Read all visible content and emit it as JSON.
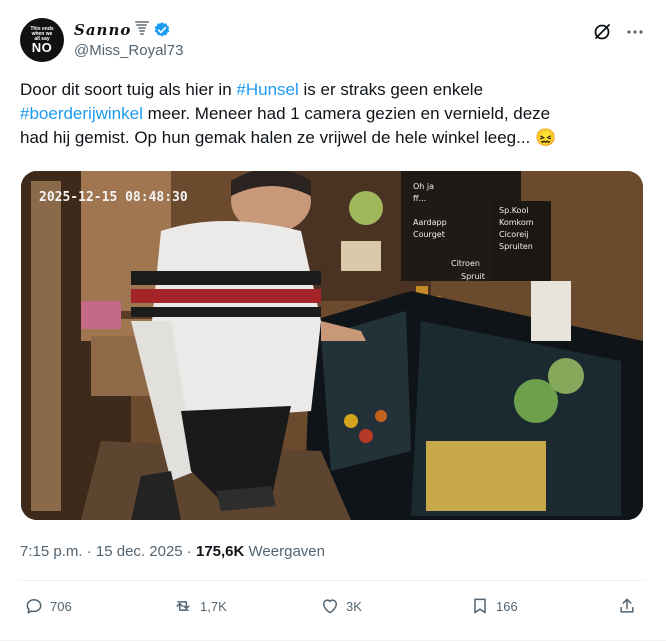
{
  "author": {
    "avatar_line1": "This ends",
    "avatar_line2": "when we",
    "avatar_line3": "all say",
    "avatar_big": "NO",
    "display_name": "Sanno",
    "name_emoji": "tornado",
    "handle": "@Miss_Royal73",
    "verified_color": "#1d9bf0"
  },
  "tweet": {
    "text_part1": "Door dit soort tuig als hier in ",
    "hashtag1": "#Hunsel",
    "text_part2": " is er straks geen enkele\n",
    "hashtag2": "#boerderijwinkel",
    "text_part3": " meer. Meneer had 1 camera gezien en vernield, deze\nhad hij gemist. Op hun gemak halen ze vrijwel de hele winkel leeg... ",
    "emoji": "😖"
  },
  "media": {
    "cctv_timestamp": "2025-12-15 08:48:30",
    "chalkboard_lines": [
      "Oh ja",
      "ff...",
      "Sp.Kool",
      "Komkom",
      "Cicoreij",
      "Spruiten",
      "Aardapp",
      "Courget",
      "Citroen",
      "Spruit"
    ],
    "description_icon": "camera-still"
  },
  "meta": {
    "time": "7:15 p.m.",
    "sep": " · ",
    "date": "15 dec. 2025",
    "views_count": "175,6K",
    "views_label": "Weergaven"
  },
  "actions": {
    "replies": "706",
    "reposts": "1,7K",
    "likes": "3K",
    "bookmarks": "166"
  },
  "colors": {
    "link": "#1d9bf0",
    "muted": "#536471",
    "text": "#0f1419"
  }
}
